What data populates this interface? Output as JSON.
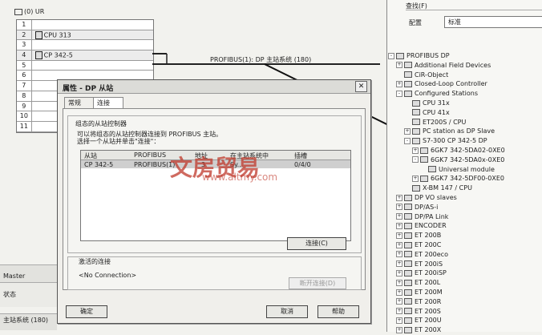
{
  "rack": {
    "title": "(0) UR",
    "slots": [
      {
        "num": "1",
        "module": ""
      },
      {
        "num": "2",
        "module": "CPU 313"
      },
      {
        "num": "3",
        "module": ""
      },
      {
        "num": "4",
        "module": "CP 342-5"
      },
      {
        "num": "5",
        "module": ""
      },
      {
        "num": "6",
        "module": ""
      },
      {
        "num": "7",
        "module": ""
      },
      {
        "num": "8",
        "module": ""
      },
      {
        "num": "9",
        "module": ""
      },
      {
        "num": "10",
        "module": ""
      },
      {
        "num": "11",
        "module": ""
      }
    ]
  },
  "bus": {
    "label": "PROFIBUS(1): DP 主站系统 (180)"
  },
  "dialog": {
    "title": "属性 - DP 从站",
    "tabs": [
      "常规",
      "连接"
    ],
    "group1_title": "组态的从站控制器",
    "group1_line1": "可以将组态的从站控制器连接到 PROFIBUS 主站。",
    "group1_line2": "选择一个从站并单击\"连接\"：",
    "columns": [
      "从站",
      "PROFIBUS",
      "地址",
      "在主站系统中",
      "插槽"
    ],
    "rows": [
      [
        "CP 342-5",
        "PROFIBUS(1)",
        "3",
        "Sy...",
        "0/4/0"
      ]
    ],
    "connect_button": "连接(C)",
    "group2_title": "激活的连接",
    "group2_value": "<No Connection>",
    "disconnect_button": "断开连接(D)",
    "ok_button": "确定",
    "cancel_button": "取消",
    "help_button": "帮助"
  },
  "bottom_left": {
    "line1": "Master",
    "line2": "状态",
    "line3": "主站系统 (180)"
  },
  "catalog": {
    "find_label": "查找(F)",
    "profile_label": "配置",
    "profile_value": "标准",
    "tree": [
      {
        "label": "PROFIBUS DP",
        "indent": 0,
        "exp": "-"
      },
      {
        "label": "Additional Field Devices",
        "indent": 1,
        "exp": "+"
      },
      {
        "label": "CiR-Object",
        "indent": 1,
        "exp": ""
      },
      {
        "label": "Closed-Loop Controller",
        "indent": 1,
        "exp": "+"
      },
      {
        "label": "Configured Stations",
        "indent": 1,
        "exp": "-"
      },
      {
        "label": "CPU 31x",
        "indent": 2,
        "exp": ""
      },
      {
        "label": "CPU 41x",
        "indent": 2,
        "exp": ""
      },
      {
        "label": "ET200S / CPU",
        "indent": 2,
        "exp": ""
      },
      {
        "label": "PC station as DP Slave",
        "indent": 2,
        "exp": "+"
      },
      {
        "label": "S7-300 CP 342-5 DP",
        "indent": 2,
        "exp": "-"
      },
      {
        "label": "6GK7 342-5DA02-0XE0",
        "indent": 3,
        "exp": "+"
      },
      {
        "label": "6GK7 342-5DA0x-0XE0",
        "indent": 3,
        "exp": "-"
      },
      {
        "label": "Universal module",
        "indent": 4,
        "exp": ""
      },
      {
        "label": "6GK7 342-5DF00-0XE0",
        "indent": 3,
        "exp": "+"
      },
      {
        "label": "X-BM 147 / CPU",
        "indent": 2,
        "exp": ""
      },
      {
        "label": "DP VO slaves",
        "indent": 1,
        "exp": "+"
      },
      {
        "label": "DP/AS-i",
        "indent": 1,
        "exp": "+"
      },
      {
        "label": "DP/PA Link",
        "indent": 1,
        "exp": "+"
      },
      {
        "label": "ENCODER",
        "indent": 1,
        "exp": "+"
      },
      {
        "label": "ET 200B",
        "indent": 1,
        "exp": "+"
      },
      {
        "label": "ET 200C",
        "indent": 1,
        "exp": "+"
      },
      {
        "label": "ET 200eco",
        "indent": 1,
        "exp": "+"
      },
      {
        "label": "ET 200iS",
        "indent": 1,
        "exp": "+"
      },
      {
        "label": "ET 200iSP",
        "indent": 1,
        "exp": "+"
      },
      {
        "label": "ET 200L",
        "indent": 1,
        "exp": "+"
      },
      {
        "label": "ET 200M",
        "indent": 1,
        "exp": "+"
      },
      {
        "label": "ET 200R",
        "indent": 1,
        "exp": "+"
      },
      {
        "label": "ET 200S",
        "indent": 1,
        "exp": "+"
      },
      {
        "label": "ET 200U",
        "indent": 1,
        "exp": "+"
      },
      {
        "label": "ET 200X",
        "indent": 1,
        "exp": "+"
      }
    ]
  },
  "watermark": {
    "text": "文房贸易",
    "url": "www.altmy.com"
  }
}
